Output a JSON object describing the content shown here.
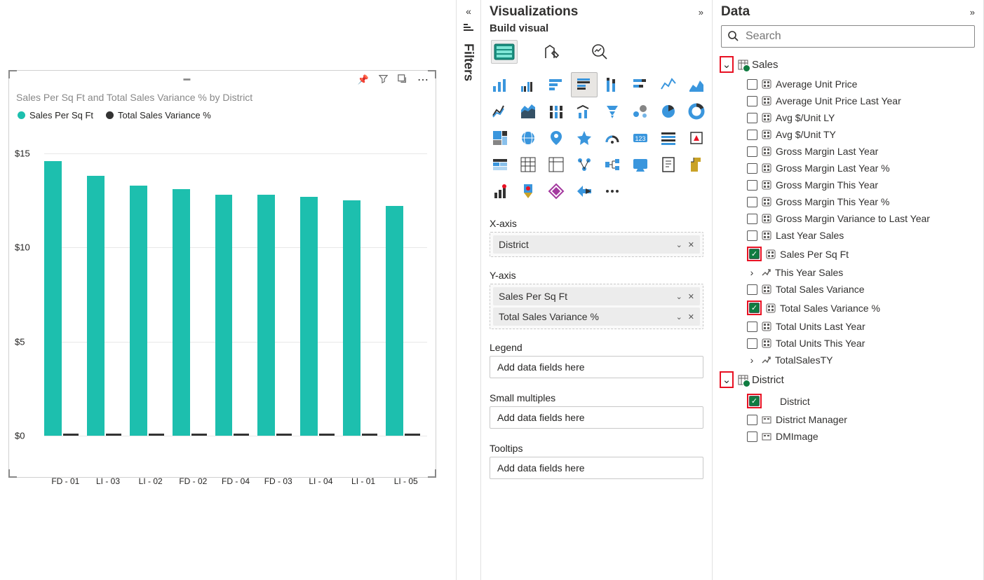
{
  "panels": {
    "visualizations_title": "Visualizations",
    "build_visual": "Build visual",
    "data_title": "Data",
    "filters_title": "Filters"
  },
  "chart_tile": {
    "title": "Sales Per Sq Ft and Total Sales Variance % by District",
    "legend": [
      "Sales Per Sq Ft",
      "Total Sales Variance %"
    ]
  },
  "chart_data": {
    "type": "bar",
    "title": "Sales Per Sq Ft and Total Sales Variance % by District",
    "categories": [
      "FD - 01",
      "LI - 03",
      "LI - 02",
      "FD - 02",
      "FD - 04",
      "FD - 03",
      "LI - 04",
      "LI - 01",
      "LI - 05"
    ],
    "series": [
      {
        "name": "Sales Per Sq Ft",
        "values": [
          14.6,
          13.8,
          13.3,
          13.1,
          12.8,
          12.8,
          12.7,
          12.5,
          12.2
        ]
      },
      {
        "name": "Total Sales Variance %",
        "values": [
          0.05,
          0.04,
          0.03,
          0.04,
          0.04,
          0.03,
          0.04,
          0.05,
          0.03
        ]
      }
    ],
    "yticks": [
      "$0",
      "$5",
      "$10",
      "$15"
    ],
    "ylim": [
      0,
      16
    ],
    "ylabel": "",
    "xlabel": ""
  },
  "wells": {
    "xaxis_label": "X-axis",
    "xaxis_items": [
      "District"
    ],
    "yaxis_label": "Y-axis",
    "yaxis_items": [
      "Sales Per Sq Ft",
      "Total Sales Variance %"
    ],
    "legend_label": "Legend",
    "legend_placeholder": "Add data fields here",
    "small_label": "Small multiples",
    "small_placeholder": "Add data fields here",
    "tooltips_label": "Tooltips",
    "tooltips_placeholder": "Add data fields here"
  },
  "search_placeholder": "Search",
  "tables": {
    "sales": {
      "name": "Sales",
      "fields": [
        {
          "name": "Average Unit Price",
          "checked": false,
          "icon": "measure"
        },
        {
          "name": "Average Unit Price Last Year",
          "checked": false,
          "icon": "measure"
        },
        {
          "name": "Avg $/Unit LY",
          "checked": false,
          "icon": "measure"
        },
        {
          "name": "Avg $/Unit TY",
          "checked": false,
          "icon": "measure"
        },
        {
          "name": "Gross Margin Last Year",
          "checked": false,
          "icon": "measure"
        },
        {
          "name": "Gross Margin Last Year %",
          "checked": false,
          "icon": "measure"
        },
        {
          "name": "Gross Margin This Year",
          "checked": false,
          "icon": "measure"
        },
        {
          "name": "Gross Margin This Year %",
          "checked": false,
          "icon": "measure"
        },
        {
          "name": "Gross Margin Variance to Last Year",
          "checked": false,
          "icon": "measure"
        },
        {
          "name": "Last Year Sales",
          "checked": false,
          "icon": "measure"
        },
        {
          "name": "Sales Per Sq Ft",
          "checked": true,
          "icon": "measure",
          "highlight": true
        },
        {
          "name": "This Year Sales",
          "checked": null,
          "icon": "hierarchy"
        },
        {
          "name": "Total Sales Variance",
          "checked": false,
          "icon": "measure"
        },
        {
          "name": "Total Sales Variance %",
          "checked": true,
          "icon": "measure",
          "highlight": true
        },
        {
          "name": "Total Units Last Year",
          "checked": false,
          "icon": "measure"
        },
        {
          "name": "Total Units This Year",
          "checked": false,
          "icon": "measure"
        },
        {
          "name": "TotalSalesTY",
          "checked": null,
          "icon": "hierarchy"
        }
      ]
    },
    "district": {
      "name": "District",
      "fields": [
        {
          "name": "District",
          "checked": true,
          "icon": "blank",
          "highlight": true
        },
        {
          "name": "District Manager",
          "checked": false,
          "icon": "column"
        },
        {
          "name": "DMImage",
          "checked": false,
          "icon": "column"
        }
      ]
    }
  }
}
